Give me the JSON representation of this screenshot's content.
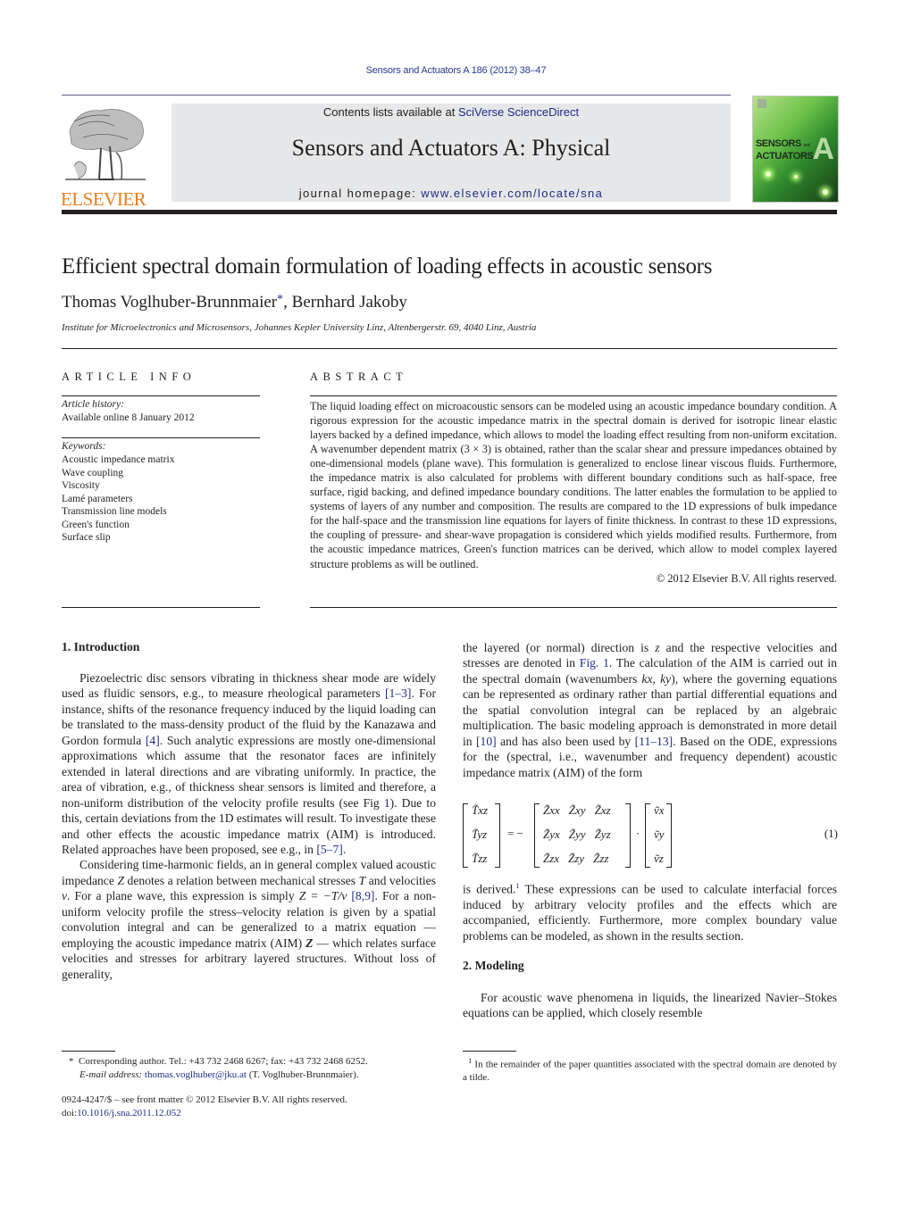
{
  "header": {
    "running_head": "Sensors and Actuators A 186 (2012) 38–47",
    "publisher_logo": "ELSEVIER",
    "contents_prefix": "Contents lists available at ",
    "contents_link": "SciVerse ScienceDirect",
    "journal_title": "Sensors and Actuators A: Physical",
    "homepage_prefix": "journal homepage: ",
    "homepage_link": "www.elsevier.com/locate/sna",
    "cover": {
      "line1": "SENSORS",
      "line1_small": "and",
      "line2": "ACTUATORS",
      "letter": "A"
    }
  },
  "article": {
    "title": "Efficient spectral domain formulation of loading effects in acoustic sensors",
    "author1": "Thomas Voglhuber-Brunnmaier",
    "author_mark": "*",
    "author_sep": ", ",
    "author2": "Bernhard Jakoby",
    "affiliation": "Institute for Microelectronics and Microsensors, Johannes Kepler University Linz, Altenbergerstr. 69, 4040 Linz, Austria"
  },
  "article_info": {
    "heading": "ARTICLE INFO",
    "history_label": "Article history:",
    "history_value": "Available online 8 January 2012",
    "keywords_label": "Keywords:",
    "keywords": [
      "Acoustic impedance matrix",
      "Wave coupling",
      "Viscosity",
      "Lamé parameters",
      "Transmission line models",
      "Green's function",
      "Surface slip"
    ]
  },
  "abstract": {
    "heading": "ABSTRACT",
    "text": "The liquid loading effect on microacoustic sensors can be modeled using an acoustic impedance boundary condition. A rigorous expression for the acoustic impedance matrix in the spectral domain is derived for isotropic linear elastic layers backed by a defined impedance, which allows to model the loading effect resulting from non-uniform excitation. A wavenumber dependent matrix (3 × 3) is obtained, rather than the scalar shear and pressure impedances obtained by one-dimensional models (plane wave). This formulation is generalized to enclose linear viscous fluids. Furthermore, the impedance matrix is also calculated for problems with different boundary conditions such as half-space, free surface, rigid backing, and defined impedance boundary conditions. The latter enables the formulation to be applied to systems of layers of any number and composition. The results are compared to the 1D expressions of bulk impedance for the half-space and the transmission line equations for layers of finite thickness. In contrast to these 1D expressions, the coupling of pressure- and shear-wave propagation is considered which yields modified results. Furthermore, from the acoustic impedance matrices, Green's function matrices can be derived, which allow to model complex layered structure problems as will be outlined.",
    "copyright": "© 2012 Elsevier B.V. All rights reserved."
  },
  "body": {
    "sec1_heading": "1.  Introduction",
    "p1": {
      "a": "Piezoelectric disc sensors vibrating in thickness shear mode are widely used as fluidic sensors, e.g., to measure rheological parameters ",
      "ref1": "[1–3]",
      "b": ". For instance, shifts of the resonance frequency induced by the liquid loading can be translated to the mass-density product of the fluid by the Kanazawa and Gordon formula ",
      "ref2": "[4]",
      "c": ". Such analytic expressions are mostly one-dimensional approximations which assume that the resonator faces are infinitely extended in lateral directions and are vibrating uniformly. In practice, the area of vibration, e.g., of thickness shear sensors is limited and therefore, a non-uniform distribution of the velocity profile results (see Fig ",
      "ref3": "1",
      "d": "). Due to this, certain deviations from the 1D estimates will result. To investigate these and other effects the acoustic impedance matrix (AIM) is introduced. Related approaches have been proposed, see e.g., in ",
      "ref4": "[5–7]",
      "e": "."
    },
    "p2": {
      "a": "Considering time-harmonic fields, an in general complex valued acoustic impedance ",
      "Z": "Z",
      "b": " denotes a relation between mechanical stresses ",
      "T": "T",
      "c": " and velocities ",
      "v": "v",
      "d": ". For a plane wave, this expression is simply ",
      "formula": "Z = −T/v",
      "e": " ",
      "ref1": "[8,9]",
      "f": ". For a non-uniform velocity profile the stress–velocity relation is given by a spatial convolution integral and can be generalized to a matrix equation — employing the acoustic impedance matrix (AIM) ",
      "Zbold": "Z",
      "g": " — which relates surface velocities and stresses for arbitrary layered structures. Without loss of generality,"
    },
    "p3": {
      "a": "the layered (or normal) direction is ",
      "z": "z",
      "b": " and the respective velocities and stresses are denoted in ",
      "ref1": "Fig. 1",
      "c": ". The calculation of the AIM is carried out in the spectral domain (wavenumbers ",
      "kx": "kx, ky",
      "d": "), where the governing equations can be represented as ordinary rather than partial differential equations and the spatial convolution integral can be replaced by an algebraic multiplication. The basic modeling approach is demonstrated in more detail in ",
      "ref2": "[10]",
      "e": " and has also been used by ",
      "ref3": "[11–13]",
      "f": ". Based on the ODE, expressions for the (spectral, i.e., wavenumber and frequency dependent) acoustic impedance matrix (AIM) of the form"
    },
    "equation": {
      "lhs": [
        "T̃xz",
        "T̃yz",
        "T̃zz"
      ],
      "sign": "= −",
      "matrix": [
        [
          "Z̃xx",
          "Z̃xy",
          "Z̃xz"
        ],
        [
          "Z̃yx",
          "Z̃yy",
          "Z̃yz"
        ],
        [
          "Z̃zx",
          "Z̃zy",
          "Z̃zz"
        ]
      ],
      "dot": "·",
      "rhs": [
        "ṽx",
        "ṽy",
        "ṽz"
      ],
      "number": "(1)"
    },
    "p4": {
      "a": "is derived.",
      "fnref": "1",
      "b": " These expressions can be used to calculate interfacial forces induced by arbitrary velocity profiles and the effects which are accompanied, efficiently. Furthermore, more complex boundary value problems can be modeled, as shown in the results section."
    },
    "sec2_heading": "2.  Modeling",
    "p5": "For acoustic wave phenomena in liquids, the linearized Navier–Stokes equations can be applied, which closely resemble"
  },
  "footnotes": {
    "corr_mark": "*",
    "corr_text": "Corresponding author. Tel.: +43 732 2468 6267; fax: +43 732 2468 6252.",
    "email_label": "E-mail address: ",
    "email": "thomas.voglhuber@jku.at",
    "email_suffix": " (T. Voglhuber-Brunnmaier).",
    "issn_line": "0924-4247/$ – see front matter © 2012 Elsevier B.V. All rights reserved.",
    "doi_prefix": "doi:",
    "doi": "10.1016/j.sna.2011.12.052",
    "fn1_mark": "1",
    "fn1_text": "In the remainder of the paper quantities associated with the spectral domain are denoted by a tilde."
  }
}
